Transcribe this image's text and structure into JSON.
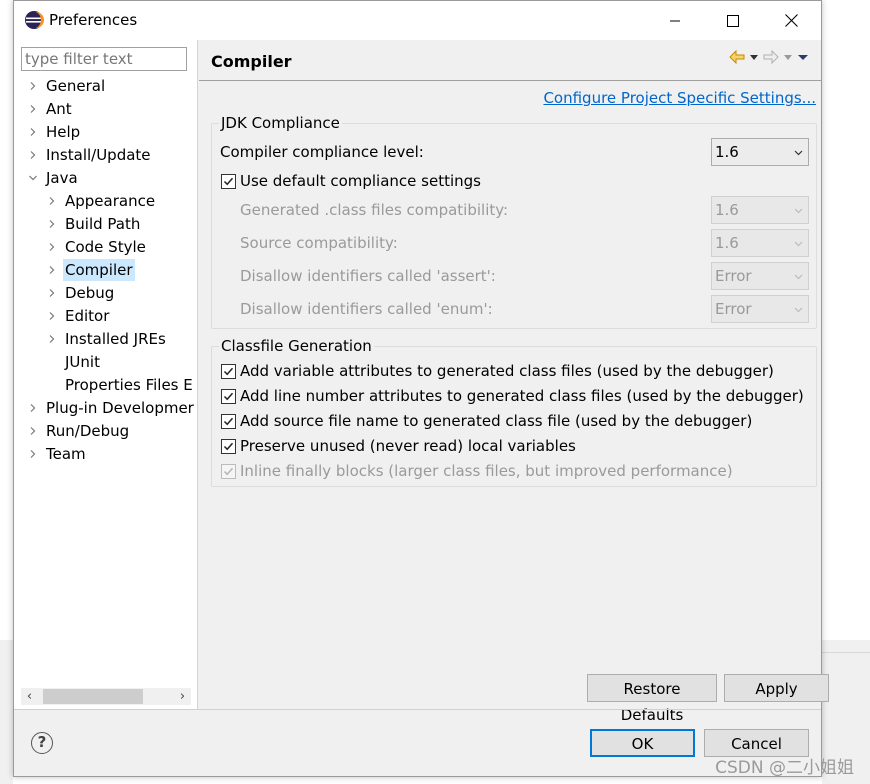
{
  "window": {
    "title": "Preferences",
    "controls": {
      "minimize": "minimize-icon",
      "maximize": "maximize-icon",
      "close": "close-icon"
    }
  },
  "sidebar": {
    "filter_placeholder": "type filter text",
    "items": [
      {
        "label": "General",
        "level": 0,
        "expander": "collapsed"
      },
      {
        "label": "Ant",
        "level": 0,
        "expander": "collapsed"
      },
      {
        "label": "Help",
        "level": 0,
        "expander": "collapsed"
      },
      {
        "label": "Install/Update",
        "level": 0,
        "expander": "collapsed"
      },
      {
        "label": "Java",
        "level": 0,
        "expander": "expanded"
      },
      {
        "label": "Appearance",
        "level": 1,
        "expander": "collapsed"
      },
      {
        "label": "Build Path",
        "level": 1,
        "expander": "collapsed"
      },
      {
        "label": "Code Style",
        "level": 1,
        "expander": "collapsed"
      },
      {
        "label": "Compiler",
        "level": 1,
        "expander": "collapsed",
        "selected": true
      },
      {
        "label": "Debug",
        "level": 1,
        "expander": "collapsed"
      },
      {
        "label": "Editor",
        "level": 1,
        "expander": "collapsed"
      },
      {
        "label": "Installed JREs",
        "level": 1,
        "expander": "collapsed"
      },
      {
        "label": "JUnit",
        "level": 1,
        "expander": "none"
      },
      {
        "label": "Properties Files E",
        "level": 1,
        "expander": "none"
      },
      {
        "label": "Plug-in Developmer",
        "level": 0,
        "expander": "collapsed"
      },
      {
        "label": "Run/Debug",
        "level": 0,
        "expander": "collapsed"
      },
      {
        "label": "Team",
        "level": 0,
        "expander": "collapsed"
      }
    ]
  },
  "page": {
    "title": "Compiler",
    "configure_link": "Configure Project Specific Settings...",
    "jdk_group": {
      "title": "JDK Compliance",
      "compliance_label": "Compiler compliance level:",
      "compliance_value": "1.6",
      "use_default_label": "Use default compliance settings",
      "use_default_checked": true,
      "settings": [
        {
          "label": "Generated .class files compatibility:",
          "value": "1.6"
        },
        {
          "label": "Source compatibility:",
          "value": "1.6"
        },
        {
          "label": "Disallow identifiers called 'assert':",
          "value": "Error"
        },
        {
          "label": "Disallow identifiers called 'enum':",
          "value": "Error"
        }
      ]
    },
    "classfile_group": {
      "title": "Classfile Generation",
      "options": [
        {
          "label": "Add variable attributes to generated class files (used by the debugger)",
          "checked": true,
          "enabled": true
        },
        {
          "label": "Add line number attributes to generated class files (used by the debugger)",
          "checked": true,
          "enabled": true
        },
        {
          "label": "Add source file name to generated class file (used by the debugger)",
          "checked": true,
          "enabled": true
        },
        {
          "label": "Preserve unused (never read) local variables",
          "checked": true,
          "enabled": true
        },
        {
          "label": "Inline finally blocks (larger class files, but improved performance)",
          "checked": true,
          "enabled": false
        }
      ]
    },
    "restore_defaults": "Restore Defaults",
    "apply": "Apply"
  },
  "footer": {
    "help_icon": "?",
    "ok": "OK",
    "cancel": "Cancel"
  },
  "watermark": "CSDN @二小姐姐",
  "colors": {
    "accent": "#0078d7",
    "selection": "#cce8ff",
    "link": "#0066cc",
    "dialog_bg": "#f0f0f0"
  }
}
